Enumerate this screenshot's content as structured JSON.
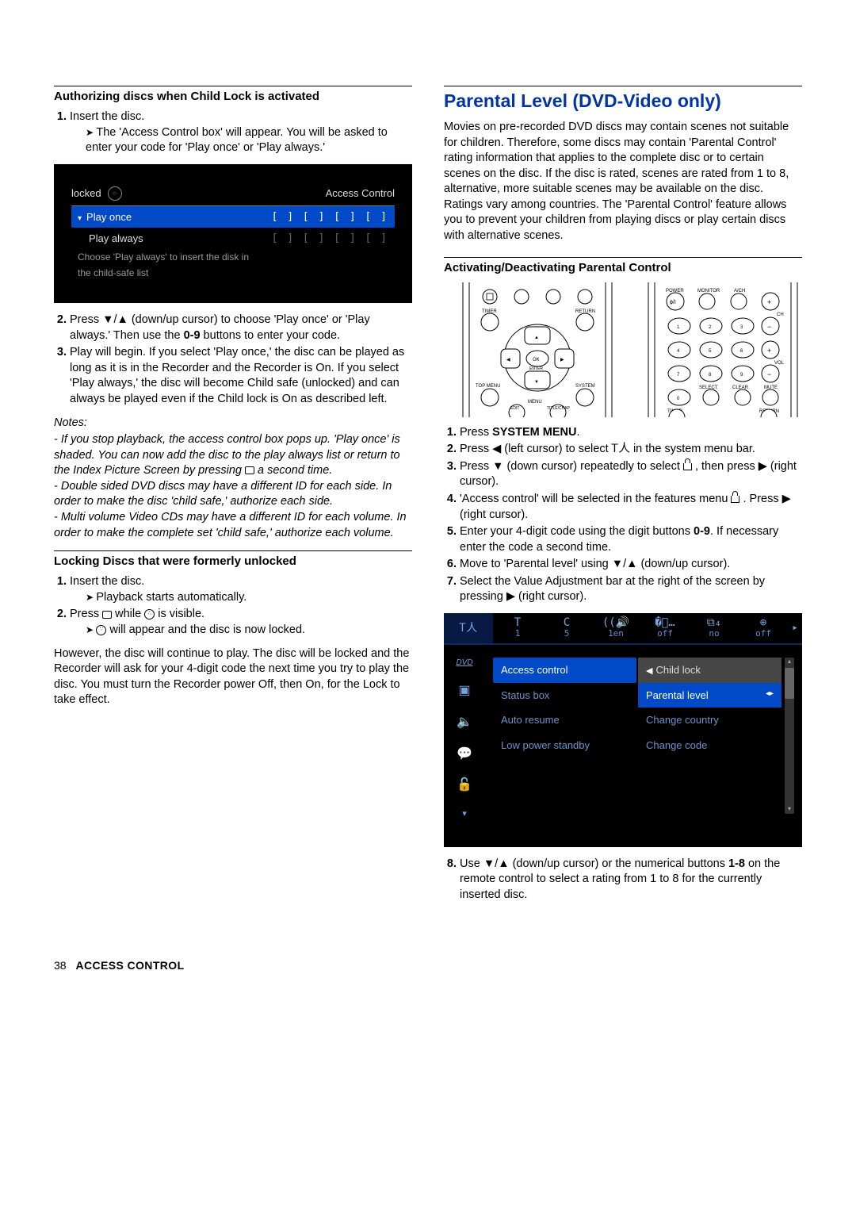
{
  "left": {
    "h1": "Authorizing discs when Child Lock is activated",
    "step1_a": "Insert the disc.",
    "step1_b": "The 'Access Control box' will appear. You will be asked to enter your code for 'Play once' or 'Play always.'",
    "ss1": {
      "locked": "locked",
      "title_right": "Access Control",
      "row_play_once": "Play once",
      "row_play_always": "Play always",
      "dots": "[ ] [ ] [ ] [ ]",
      "hint_a": "Choose 'Play always' to insert the disk in",
      "hint_b": "the child-safe list"
    },
    "step2_a": "Press ▼/▲ (down/up cursor) to choose 'Play once' or 'Play always.' Then use the ",
    "step2_b": "0-9",
    "step2_c": " buttons to enter your code.",
    "step3": "Play will begin. If you select 'Play once,' the disc can be played as long as it is in the Recorder and the Recorder is On. If you select 'Play always,' the disc will become Child safe (unlocked) and can always be played even if the Child lock is On as described left.",
    "notes_hd": "Notes:",
    "note1": "- If you stop playback, the access control box pops up. 'Play once' is shaded. You can now add the disc to the play always list or return to the Index Picture Screen by pressing ",
    "note1b": " a second time.",
    "note2": "- Double sided DVD discs may have a different ID for each side. In order to make the disc 'child safe,' authorize each side.",
    "note3": "- Multi volume Video CDs may have a different ID for each volume. In order to make the complete set 'child safe,' authorize each volume.",
    "h2": "Locking Discs that were formerly unlocked",
    "l_step1a": "Insert the disc.",
    "l_step1b": "Playback starts automatically.",
    "l_step2a": "Press ",
    "l_step2b": " while ",
    "l_step2c": " is visible.",
    "l_step2d": " will appear and the disc is now locked.",
    "l_tail": "However, the disc will continue to play. The disc will be locked and the Recorder will ask for your 4-digit code the next time you try to play the disc. You must turn the Recorder power Off, then On, for the Lock to take effect."
  },
  "right": {
    "h1": "Parental Level (DVD-Video only)",
    "intro": "Movies on pre-recorded DVD discs may contain scenes not suitable for children. Therefore, some discs may contain 'Parental Control' rating information that applies to the complete disc or to certain scenes on the disc. If the disc is rated, scenes are rated from 1 to 8, alternative, more suitable scenes may be available on the disc. Ratings vary among countries. The 'Parental Control' feature allows you to prevent your children from playing discs or play certain discs with alternative scenes.",
    "h2": "Activating/Deactivating Parental Control",
    "remote_labels": {
      "timer": "TIMER",
      "return": "RETURN",
      "ok_enter": "OK\nENTER",
      "topmenu": "TOP MENU",
      "system": "SYSTEM",
      "menu": "MENU",
      "edit": "EDIT",
      "titlechap": "TITLE/CHAP",
      "power": "POWER",
      "monitor": "MONITOR",
      "avch": "A/CH",
      "ch": "CH",
      "vol": "VOL",
      "select": "SELECT",
      "clear": "CLEAR",
      "mute": "MUTE",
      "poweron": "ϕ/I"
    },
    "s1a": "Press ",
    "s1b": "SYSTEM MENU",
    "s1c": ".",
    "s2": "Press ◀ (left cursor) to select ",
    "s2b": " in the system menu bar.",
    "s3a": "Press ▼ (down cursor) repeatedly to select ",
    "s3b": " , then press ▶ (right cursor).",
    "s4a": "'Access control' will be selected in the features menu ",
    "s4b": " . Press ▶ (right cursor).",
    "s5a": "Enter your 4-digit code using the digit buttons ",
    "s5b": "0-9",
    "s5c": ". If necessary enter the code a second time.",
    "s6": "Move to 'Parental level' using ▼/▲ (down/up cursor).",
    "s7": "Select the Value Adjustment bar at the right of the screen by pressing ▶ (right cursor).",
    "ss2": {
      "top": [
        "",
        "T",
        "C",
        "",
        "",
        "",
        "",
        ""
      ],
      "top_lbl": [
        "",
        "1",
        "5",
        "1en",
        "off",
        "no",
        "off",
        ""
      ],
      "left_items": {
        "dvd": "DVD"
      },
      "list_left": [
        "Access control",
        "Status box",
        "Auto resume",
        "Low power standby"
      ],
      "list_right_head": "Child lock",
      "list_right_sel": "Parental level",
      "list_right": [
        "Change country",
        "Change code"
      ]
    },
    "s8a": "Use ▼/▲ (down/up cursor) or the numerical buttons ",
    "s8b": "1-8",
    "s8c": " on the remote control to select a rating from 1 to 8 for the currently inserted disc."
  },
  "footer": {
    "page": "38",
    "section": "ACCESS CONTROL"
  }
}
